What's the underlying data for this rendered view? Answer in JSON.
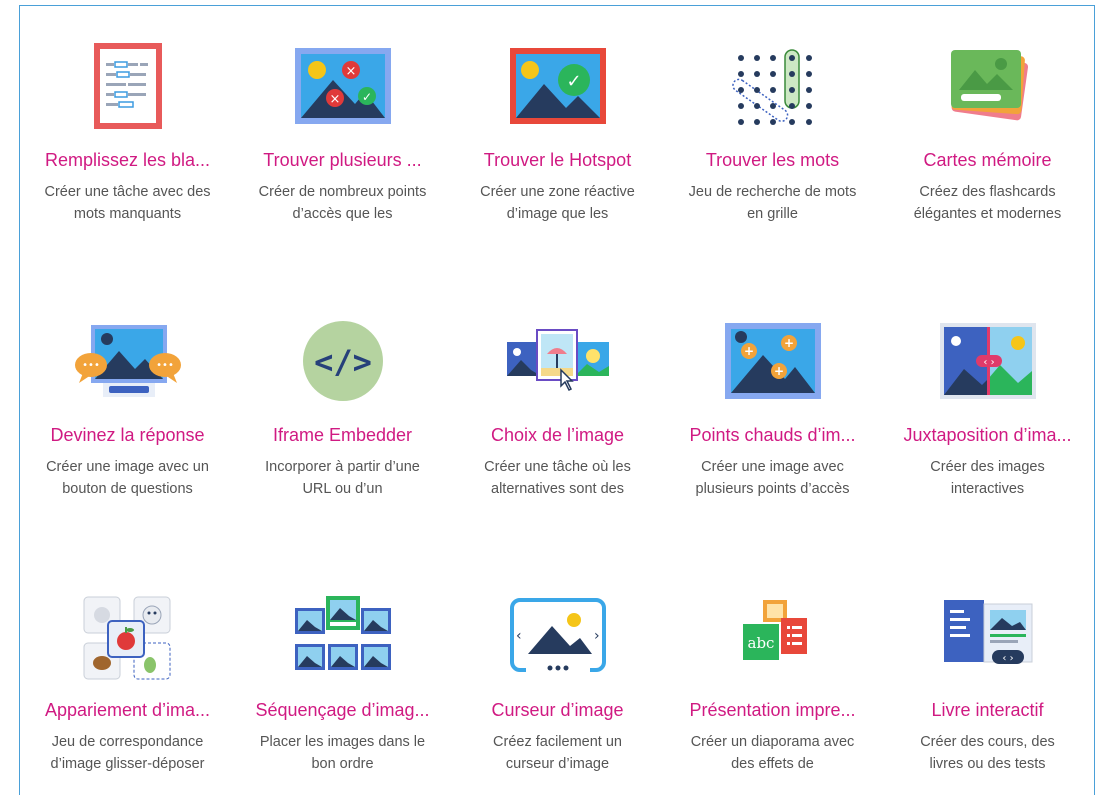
{
  "items": [
    {
      "title": "Remplissez les bla...",
      "desc": "Créer une tâche avec des mots manquants",
      "icon": "fill-blanks-icon"
    },
    {
      "title": "Trouver plusieurs ...",
      "desc": "Créer de nombreux points d’accès que les",
      "icon": "find-multiple-hotspots-icon"
    },
    {
      "title": "Trouver le Hotspot",
      "desc": "Créer une zone réactive d’image que les",
      "icon": "find-hotspot-icon"
    },
    {
      "title": "Trouver les mots",
      "desc": "Jeu de recherche de mots en grille",
      "icon": "find-words-icon"
    },
    {
      "title": "Cartes mémoire",
      "desc": "Créez des flashcards élégantes et modernes",
      "icon": "flashcards-icon"
    },
    {
      "title": "Devinez la réponse",
      "desc": "Créer une image avec un bouton de questions",
      "icon": "guess-answer-icon"
    },
    {
      "title": "Iframe Embedder",
      "desc": "Incorporer à partir d’une URL ou d’un",
      "icon": "iframe-embedder-icon"
    },
    {
      "title": "Choix de l’image",
      "desc": "Créer une tâche où les alternatives sont des",
      "icon": "image-choice-icon"
    },
    {
      "title": "Points chauds d’im...",
      "desc": "Créer une image avec plusieurs points d’accès",
      "icon": "image-hotspots-icon"
    },
    {
      "title": "Juxtaposition d’ima...",
      "desc": "Créer des images interactives",
      "icon": "image-juxtaposition-icon"
    },
    {
      "title": "Appariement d’ima...",
      "desc": "Jeu de correspondance d’image glisser-déposer",
      "icon": "image-pairing-icon"
    },
    {
      "title": "Séquençage d’imag...",
      "desc": "Placer les images dans le bon ordre",
      "icon": "image-sequencing-icon"
    },
    {
      "title": "Curseur d’image",
      "desc": "Créez facilement un curseur d’image",
      "icon": "image-slider-icon"
    },
    {
      "title": "Présentation impre...",
      "desc": "Créer un diaporama avec des effets de",
      "icon": "impressive-presentation-icon"
    },
    {
      "title": "Livre interactif",
      "desc": "Créer des cours, des livres ou des tests",
      "icon": "interactive-book-icon"
    }
  ],
  "colors": {
    "title": "#d01a82",
    "desc": "#555555",
    "border": "#4aa0d8"
  }
}
